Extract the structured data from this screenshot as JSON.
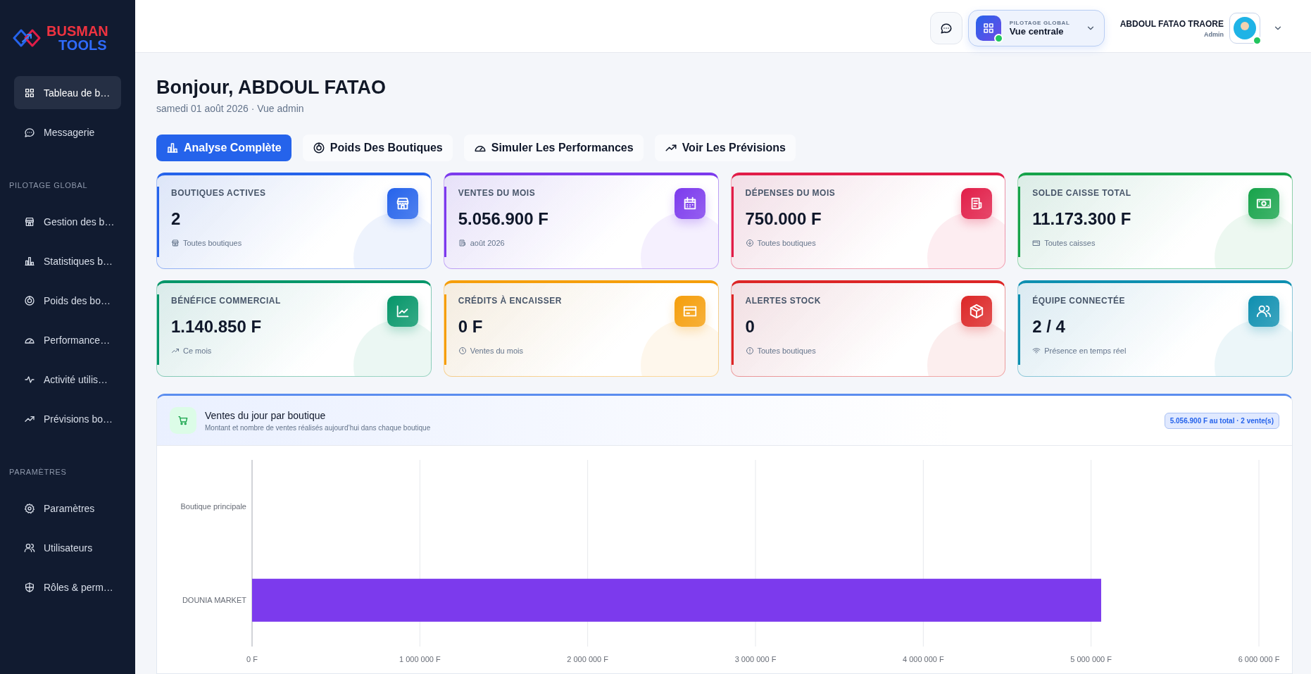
{
  "sidebar": {
    "logo": {
      "line_1": "BUSMAN",
      "line_2": "TOOLS"
    },
    "sections": [
      {
        "items": [
          {
            "label": "Tableau de b…",
            "selected": true
          },
          {
            "label": "Messagerie",
            "selected": false
          }
        ]
      },
      {
        "title": "PILOTAGE GLOBAL",
        "items": [
          {
            "label": "Gestion des b…",
            "selected": false
          },
          {
            "label": "Statistiques b…",
            "selected": false
          },
          {
            "label": "Poids des bo…",
            "selected": false
          },
          {
            "label": "Performance…",
            "selected": false
          },
          {
            "label": "Activité utilis…",
            "selected": false
          },
          {
            "label": "Prévisions bo…",
            "selected": false
          }
        ]
      },
      {
        "title": "PARAMÈTRES",
        "items": [
          {
            "label": "Paramètres",
            "selected": false
          },
          {
            "label": "Utilisateurs",
            "selected": false
          },
          {
            "label": "Rôles & perm…",
            "selected": false
          }
        ]
      }
    ]
  },
  "header": {
    "pilotage": {
      "label": "PILOTAGE GLOBAL",
      "value": "Vue centrale",
      "online": true
    },
    "user": {
      "name": "ABDOUL FATAO TRAORE",
      "role": "Admin",
      "online": true
    }
  },
  "greeting": {
    "title": "Bonjour, ABDOUL FATAO",
    "subtitle": "samedi 01 août 2026 · Vue admin"
  },
  "tabs": [
    {
      "label": "Analyse Complète",
      "selected": true
    },
    {
      "label": "Poids Des Boutiques",
      "selected": false
    },
    {
      "label": "Simuler Les Performances",
      "selected": false
    },
    {
      "label": "Voir Les Prévisions",
      "selected": false
    }
  ],
  "stat_cards": [
    {
      "label": "BOUTIQUES ACTIVES",
      "value": "2",
      "note": "Toutes boutiques",
      "color": "#2563eb"
    },
    {
      "label": "VENTES DU MOIS",
      "value": "5.056.900 F",
      "note": "août 2026",
      "color": "#7c3aed"
    },
    {
      "label": "DÉPENSES DU MOIS",
      "value": "750.000 F",
      "note": "Toutes boutiques",
      "color": "#e11d48"
    },
    {
      "label": "SOLDE CAISSE TOTAL",
      "value": "11.173.300 F",
      "note": "Toutes caisses",
      "color": "#16a34a"
    },
    {
      "label": "BÉNÉFICE COMMERCIAL",
      "value": "1.140.850 F",
      "note": "Ce mois",
      "color": "#059669"
    },
    {
      "label": "CRÉDITS À ENCAISSER",
      "value": "0 F",
      "note": "Ventes du mois",
      "color": "#f59e0b"
    },
    {
      "label": "ALERTES STOCK",
      "value": "0",
      "note": "Toutes boutiques",
      "color": "#dc2626"
    },
    {
      "label": "ÉQUIPE CONNECTÉE",
      "value": "2 / 4",
      "note": "Présence en temps réel",
      "color": "#0e8fb0"
    }
  ],
  "sales_panel": {
    "title": "Ventes du jour par boutique",
    "subtitle": "Montant et nombre de ventes réalisés aujourd’hui dans chaque boutique",
    "badge": "5.056.900 F au total · 2 vente(s)",
    "chart_data": {
      "type": "bar",
      "orientation": "horizontal",
      "categories": [
        "Boutique principale",
        "DOUNIA MARKET"
      ],
      "grid": true,
      "series": [
        {
          "color": "#7c3aed",
          "values": [
            0,
            5060000
          ]
        }
      ],
      "xlim": [
        0,
        6000000
      ],
      "xticks": [
        {
          "value": 0,
          "label": "0 F"
        },
        {
          "value": 1000000,
          "label": "1 000 000 F"
        },
        {
          "value": 2000000,
          "label": "2 000 000 F"
        },
        {
          "value": 3000000,
          "label": "3 000 000 F"
        },
        {
          "value": 4000000,
          "label": "4 000 000 F"
        },
        {
          "value": 5000000,
          "label": "5 000 000 F"
        },
        {
          "value": 6000000,
          "label": "6 000 000 F"
        }
      ]
    }
  }
}
